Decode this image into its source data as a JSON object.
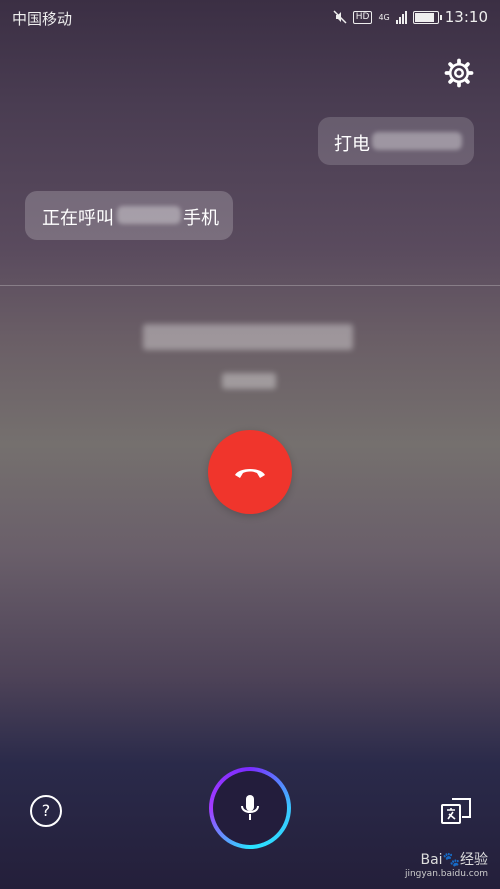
{
  "status_bar": {
    "carrier": "中国移动",
    "hd_badge": "HD",
    "network": "4G",
    "time": "13:10"
  },
  "conversation": {
    "user_message": "打电",
    "assistant_message_prefix": "正在呼叫",
    "assistant_message_suffix": "手机"
  },
  "call": {
    "end_call_color": "#f0352c"
  },
  "icons": {
    "settings": "gear-icon",
    "help": "help-icon",
    "mic": "mic-icon",
    "translate": "translate-icon",
    "mute": "mute-icon",
    "end_call": "phone-hangup-icon"
  },
  "bottom_bar": {
    "help_label": "?"
  },
  "watermark": {
    "brand": "Bai🐾经验",
    "site": "jingyan.baidu.com"
  }
}
